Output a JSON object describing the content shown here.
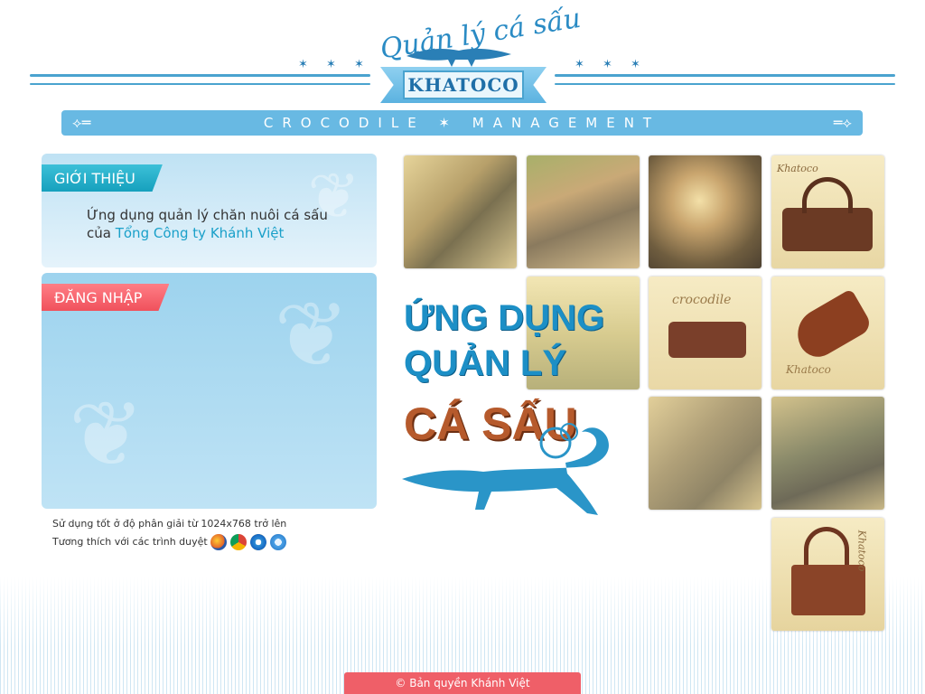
{
  "header": {
    "logo_script": "Quản lý cá sấu",
    "logo_brand": "KHATOCO",
    "stars_left": "✶ ✶ ✶",
    "stars_right": "✶ ✶ ✶",
    "banner_text": "CROCODILE ✶ MANAGEMENT"
  },
  "intro": {
    "tab_label": "GIỚI THIỆU",
    "text_prefix": "Ứng dụng quản lý chăn nuôi cá sấu của ",
    "text_highlight": "Tổng Công ty Khánh Việt"
  },
  "login": {
    "tab_label": "ĐĂNG NHẬP"
  },
  "notes": {
    "resolution": "Sử dụng tốt ở độ phân giải từ 1024x768 trở lên",
    "browsers": "Tương thích với các trình duyệt"
  },
  "browsers": [
    "firefox-icon",
    "chrome-icon",
    "ie-icon",
    "safari-icon"
  ],
  "promo": {
    "line1": "ỨNG DỤNG",
    "line2": "QUẢN LÝ",
    "line3": "CÁ SẤU"
  },
  "photo_labels": {
    "bag": "Khatoco",
    "wallet": "crocodile",
    "shoe": "Khatoco",
    "handbag": "Khatoco"
  },
  "footer": {
    "copyright": "© Bản quyền Khánh Việt"
  },
  "colors": {
    "accent_blue": "#68b9e3",
    "tab_cyan": "#16a0bd",
    "tab_red": "#f0515c",
    "footer_red": "#ef5f68"
  }
}
